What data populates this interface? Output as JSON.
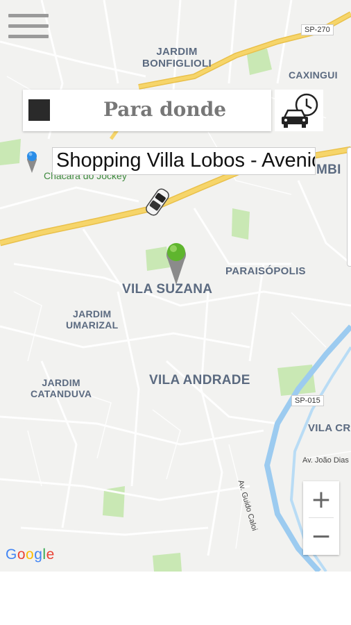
{
  "map": {
    "areas": [
      {
        "name": "jardim-bonfiglioli",
        "text": "JARDIM\nBONFIGLIOLI"
      },
      {
        "name": "caxingui",
        "text": "CAXINGUI"
      },
      {
        "name": "vila-suzana",
        "text": "VILA SUZANA"
      },
      {
        "name": "paraisopolis",
        "text": "PARAISÓPOLIS"
      },
      {
        "name": "jardim-umarizal",
        "text": "JARDIM\nUMARIZAL"
      },
      {
        "name": "jardim-catanduva",
        "text": "JARDIM\nCATANDUVA"
      },
      {
        "name": "vila-andrade",
        "text": "VILA ANDRADE"
      },
      {
        "name": "vila-cr",
        "text": "VILA CR"
      },
      {
        "name": "mbi",
        "text": "MBI"
      }
    ],
    "shields": {
      "sp270": "SP-270",
      "sp015": "SP-015"
    },
    "roads": {
      "joao_dias": "Av. João Dias",
      "guido_caloi": "Av. Guido Caloi"
    },
    "green_label": "Chácara do Jockey",
    "google": [
      "G",
      "o",
      "o",
      "g",
      "l",
      "e"
    ],
    "google_colors": [
      "#4285F4",
      "#EA4335",
      "#FBBC05",
      "#4285F4",
      "#34A853",
      "#EA4335"
    ]
  },
  "search": {
    "placeholder": "Para donde"
  },
  "destination": {
    "text": "Shopping Villa Lobos - Avenida"
  },
  "zoom": {
    "in": "+",
    "out": "−"
  },
  "colors": {
    "highway": "#f6d56a",
    "water": "#9ccbf0",
    "park": "#c9e8b4",
    "pin_green": "#5fb52e",
    "pin_blue": "#2a8de8"
  },
  "icons": {
    "menu": "menu-icon",
    "schedule": "car-clock-icon",
    "car": "car-icon",
    "origin_pin": "green-pin-icon",
    "destination_pin": "blue-pin-icon"
  }
}
